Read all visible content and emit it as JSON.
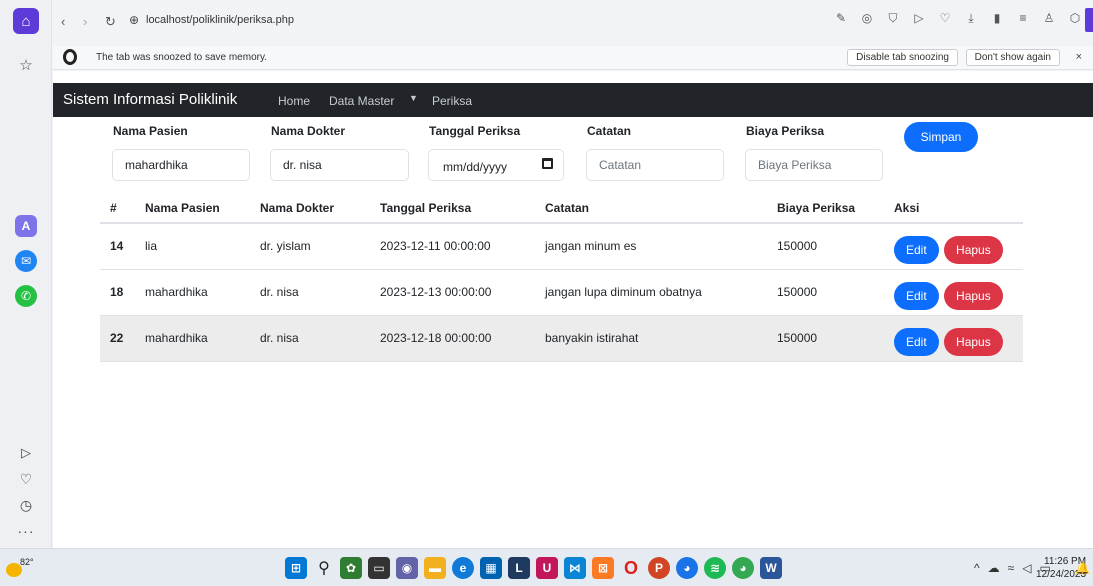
{
  "browser": {
    "url": "localhost/poliklinik/periksa.php",
    "snooze_message": "The tab was snoozed to save memory.",
    "disable_snoozing_label": "Disable tab snoozing",
    "dont_show_label": "Don't show again",
    "close_label": "×"
  },
  "navbar": {
    "brand": "Sistem Informasi Poliklinik",
    "home": "Home",
    "data_master": "Data Master",
    "periksa": "Periksa"
  },
  "form": {
    "nama_pasien_label": "Nama Pasien",
    "nama_pasien_value": "mahardhika",
    "nama_dokter_label": "Nama Dokter",
    "nama_dokter_value": "dr. nisa",
    "tanggal_label": "Tanggal Periksa",
    "tanggal_placeholder": "mm/dd/yyyy",
    "catatan_label": "Catatan",
    "catatan_placeholder": "Catatan",
    "biaya_label": "Biaya Periksa",
    "biaya_placeholder": "Biaya Periksa",
    "simpan_label": "Simpan"
  },
  "table": {
    "headers": [
      "#",
      "Nama Pasien",
      "Nama Dokter",
      "Tanggal Periksa",
      "Catatan",
      "Biaya Periksa",
      "Aksi"
    ],
    "rows": [
      {
        "id": "14",
        "pasien": "lia",
        "dokter": "dr. yislam",
        "tanggal": "2023-12-11 00:00:00",
        "catatan": "jangan minum es",
        "biaya": "150000"
      },
      {
        "id": "18",
        "pasien": "mahardhika",
        "dokter": "dr. nisa",
        "tanggal": "2023-12-13 00:00:00",
        "catatan": "jangan lupa diminum obatnya",
        "biaya": "150000"
      },
      {
        "id": "22",
        "pasien": "mahardhika",
        "dokter": "dr. nisa",
        "tanggal": "2023-12-18 00:00:00",
        "catatan": "banyakin istirahat",
        "biaya": "150000"
      }
    ],
    "edit_label": "Edit",
    "hapus_label": "Hapus"
  },
  "taskbar": {
    "weather_temp": "82°",
    "time": "11:26 PM",
    "date": "12/24/2023"
  },
  "colors": {
    "primary": "#0d6efd",
    "danger": "#dc3545",
    "navbar": "#212529",
    "opera_accent": "#5c3bd9"
  }
}
